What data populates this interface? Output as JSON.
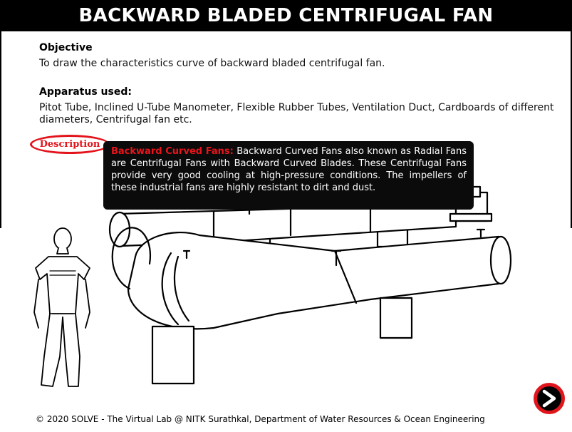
{
  "header": {
    "title": "BACKWARD BLADED CENTRIFUGAL FAN"
  },
  "objective": {
    "heading": "Objective",
    "text": "To draw the characteristics curve of backward bladed centrifugal fan."
  },
  "apparatus": {
    "heading": "Apparatus used:",
    "line1": "Pitot Tube, Inclined U-Tube Manometer, Flexible Rubber Tubes, Ventilation Duct, Cardboards of different",
    "line2": "diameters, Centrifugal fan etc."
  },
  "description_button": {
    "label": "Description"
  },
  "tooltip": {
    "heading": "Backward Curved Fans:",
    "body": " Backward Curved Fans also known as Radial Fans are Centrifugal Fans with Backward Curved Blades. These Centrifugal Fans provide very good cooling at high-pressure conditions. The impellers of these industrial fans are highly resistant to dirt and dust."
  },
  "navigation": {
    "next_icon": "next-arrow-icon"
  },
  "footer": {
    "text": "© 2020 SOLVE - The Virtual Lab @ NITK Surathkal, Department of Water Resources & Ocean Engineering"
  },
  "colors": {
    "accent": "#e3141c",
    "header_bg": "#000000",
    "tooltip_bg": "#0b0b0b"
  }
}
